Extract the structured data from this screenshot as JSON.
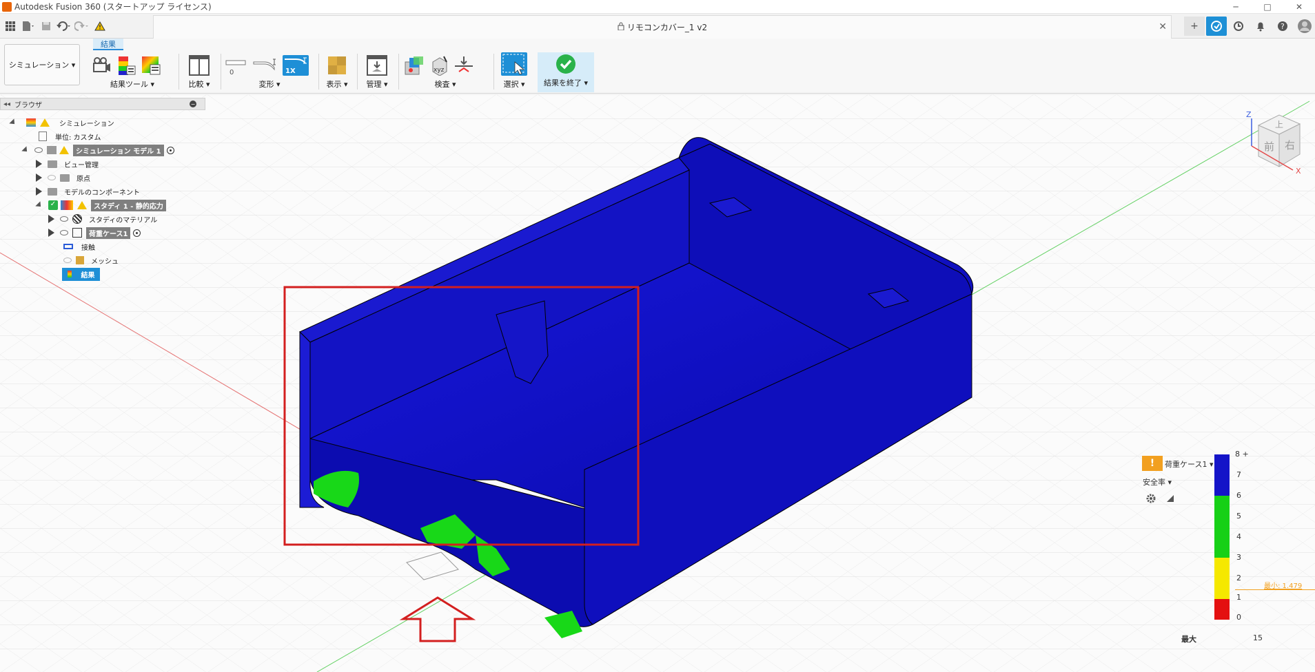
{
  "window": {
    "title": "Autodesk Fusion 360 (スタートアップ ライセンス)",
    "min": "─",
    "max": "□",
    "close": "✕"
  },
  "document": {
    "tab_title": "リモコンカバー_1 v2",
    "close": "✕"
  },
  "toolbar": {
    "workspace": "シミュレーション ▾",
    "active_tab": "結果",
    "groups": [
      {
        "label": "結果ツール ▾"
      },
      {
        "label": "比較 ▾"
      },
      {
        "label": "変形 ▾"
      },
      {
        "label": "表示 ▾"
      },
      {
        "label": "管理 ▾"
      },
      {
        "label": "検査 ▾"
      },
      {
        "label": "選択 ▾"
      },
      {
        "label": "結果を終了 ▾"
      }
    ],
    "deform_zero": "0",
    "deform_1x": "1X"
  },
  "browser": {
    "title": "ブラウザ",
    "items": [
      {
        "label": "シミュレーション"
      },
      {
        "label": "単位: カスタム"
      },
      {
        "label": "シミュレーション モデル 1"
      },
      {
        "label": "ビュー管理"
      },
      {
        "label": "原点"
      },
      {
        "label": "モデルのコンポーネント"
      },
      {
        "label": "スタディ 1 - 静的応力"
      },
      {
        "label": "スタディのマテリアル"
      },
      {
        "label": "荷重ケース1"
      },
      {
        "label": "接触"
      },
      {
        "label": "メッシュ"
      },
      {
        "label": "結果"
      }
    ]
  },
  "legend": {
    "load_case": "荷重ケース1 ▾",
    "result_type": "安全率 ▾",
    "ticks": [
      "8 +",
      "7",
      "6",
      "5",
      "4",
      "3",
      "2",
      "1",
      "0"
    ],
    "min_label": "最小: 1.479",
    "max_key": "最大",
    "max_value": "15",
    "colors": {
      "blue": "#1414c8",
      "green": "#16d016",
      "yellow": "#f5e800",
      "red": "#e41010"
    }
  },
  "viewcube": {
    "top": "上",
    "front": "前",
    "right": "右",
    "z": "Z",
    "x": "X"
  },
  "icons": [
    "apps-grid-icon",
    "file-icon",
    "save-icon",
    "undo-icon",
    "redo-icon",
    "warning-icon",
    "lock-icon",
    "plus-icon",
    "extensions-icon",
    "history-icon",
    "notification-icon",
    "help-icon",
    "user-avatar-icon"
  ]
}
